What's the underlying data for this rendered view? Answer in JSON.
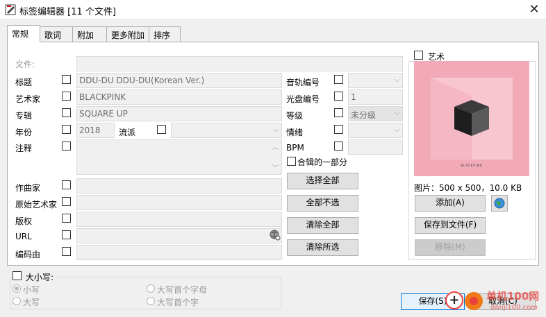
{
  "window": {
    "title": "标签编辑器 [11 个文件]",
    "close": "✕"
  },
  "tabs": [
    "常规",
    "歌词",
    "附加",
    "更多附加",
    "排序"
  ],
  "fields": {
    "file": {
      "label": "文件:",
      "value": ""
    },
    "title": {
      "label": "标题",
      "value": "DDU-DU DDU-DU(Korean Ver.)"
    },
    "artist": {
      "label": "艺术家",
      "value": "BLACKPINK"
    },
    "album": {
      "label": "专辑",
      "value": "SQUARE UP"
    },
    "year": {
      "label": "年份",
      "value": "2018"
    },
    "genre": {
      "label": "流派",
      "value": ""
    },
    "comment": {
      "label": "注释",
      "value": ""
    },
    "composer": {
      "label": "作曲家",
      "value": ""
    },
    "orig_artist": {
      "label": "原始艺术家",
      "value": ""
    },
    "copyright": {
      "label": "版权",
      "value": ""
    },
    "url": {
      "label": "URL",
      "value": ""
    },
    "encoded_by": {
      "label": "编码由",
      "value": ""
    }
  },
  "right_fields": {
    "track": {
      "label": "音轨编号",
      "value": ""
    },
    "disc": {
      "label": "光盘编号",
      "value": "1"
    },
    "rating": {
      "label": "等级",
      "value": "未分级"
    },
    "mood": {
      "label": "情绪",
      "value": ""
    },
    "bpm": {
      "label": "BPM",
      "value": ""
    },
    "compilation": {
      "label": "合辑的一部分"
    }
  },
  "buttons": {
    "select_all": "选择全部",
    "select_none": "全部不选",
    "clear_all": "清除全部",
    "clear_selected": "清除所选"
  },
  "art": {
    "label": "艺术",
    "cover_text": "BLACKPINK",
    "info": "图片：500 x 500，10.0 KB",
    "add": "添加(A)",
    "save_to_file": "保存到文件(F)",
    "remove": "移除(M)"
  },
  "case": {
    "label": "大小写:",
    "options": [
      "小写",
      "大写首个字母",
      "大写",
      "大写首个字"
    ]
  },
  "footer": {
    "save": "保存(S)",
    "cancel": "取消(C)"
  },
  "watermark": {
    "text": "单机100网",
    "url": "danji100.com"
  },
  "colors": {
    "cover_bg": "#f2aab9",
    "watermark": "#e8403a"
  }
}
